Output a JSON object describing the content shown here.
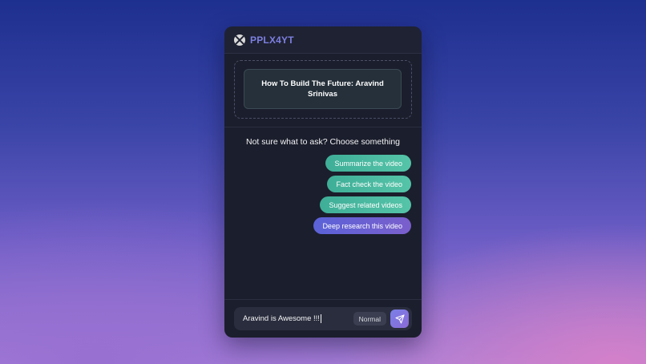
{
  "app": {
    "brand": "PPLX4YT"
  },
  "video": {
    "title": "How To Build The Future: Aravind Srinivas"
  },
  "prompt": {
    "text": "Not sure what to ask? Choose something"
  },
  "suggestions": [
    {
      "label": "Summarize the video",
      "variant": "green"
    },
    {
      "label": "Fact check the video",
      "variant": "green"
    },
    {
      "label": "Suggest related videos",
      "variant": "green"
    },
    {
      "label": "Deep research this video",
      "variant": "purple"
    }
  ],
  "input": {
    "value": "Aravind is Awesome !!!",
    "mode": "Normal"
  },
  "icons": {
    "logo": "pplx-logo-icon",
    "send": "send-icon"
  },
  "colors": {
    "brand": "#7c7fe0",
    "chip_green": "#4fbf9f",
    "chip_purple": "#6a62d4",
    "panel_bg": "#1b1e2c"
  }
}
